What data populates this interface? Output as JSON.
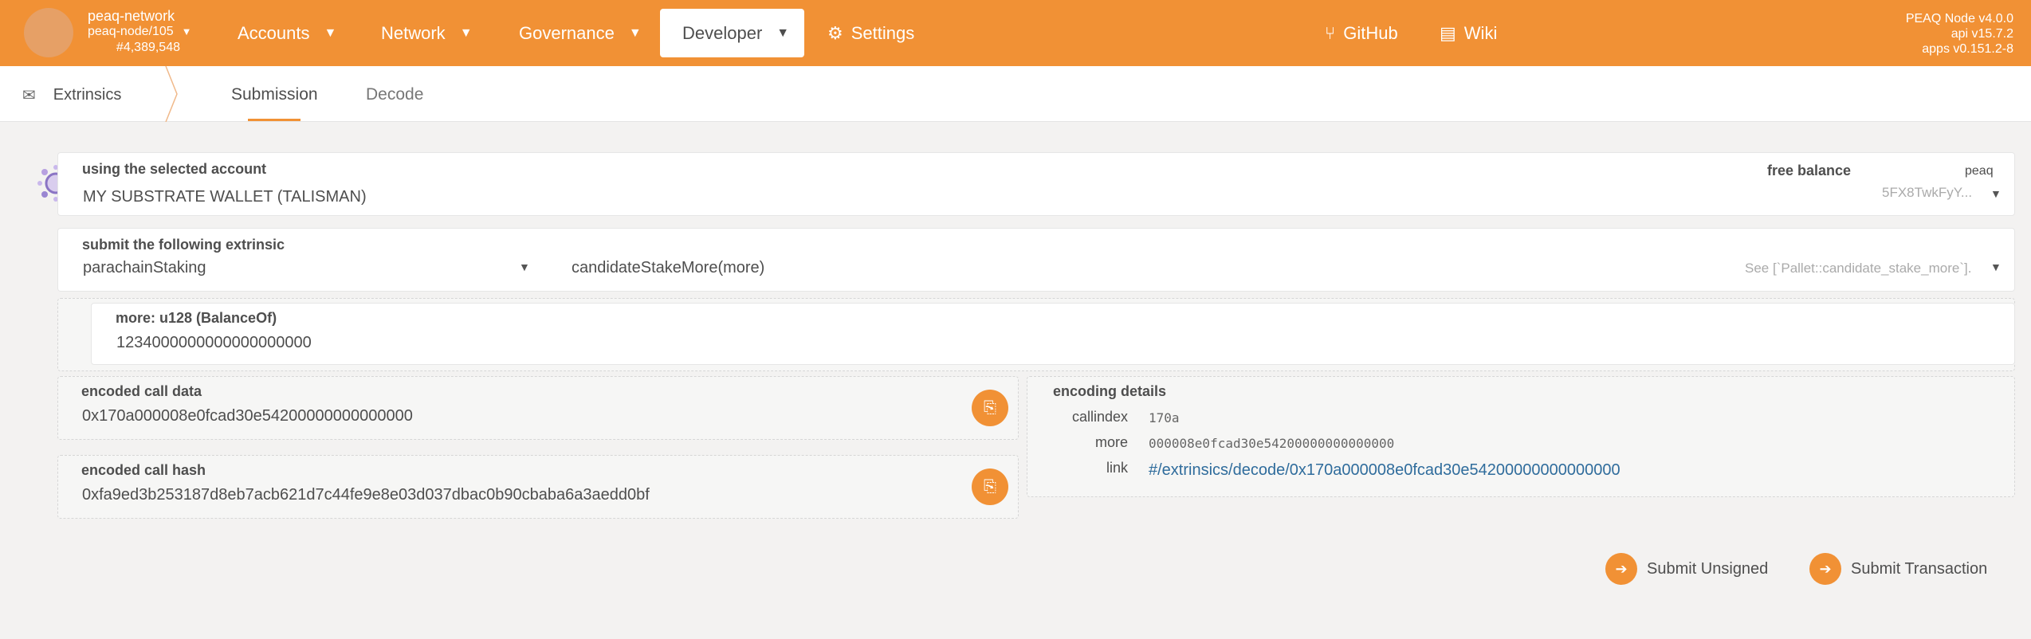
{
  "topbar": {
    "chain_name": "peaq-network",
    "node": "peaq-node/105",
    "block": "#4,389,548",
    "nav": {
      "accounts": "Accounts",
      "network": "Network",
      "governance": "Governance",
      "developer": "Developer",
      "settings": "Settings",
      "github": "GitHub",
      "wiki": "Wiki"
    },
    "node_info": {
      "name": "PEAQ Node v4.0.0",
      "api": "api v15.7.2",
      "apps": "apps v0.151.2-8"
    }
  },
  "tabs": {
    "section": "Extrinsics",
    "submission": "Submission",
    "decode": "Decode"
  },
  "account": {
    "label": "using the selected account",
    "value": "MY SUBSTRATE WALLET (TALISMAN)",
    "free_balance_label": "free balance",
    "balance_unit": "peaq",
    "address": "5FX8TwkFyY..."
  },
  "extrinsic": {
    "label": "submit the following extrinsic",
    "pallet": "parachainStaking",
    "method": "candidateStakeMore(more)",
    "doc": "See [`Pallet::candidate_stake_more`]."
  },
  "param": {
    "label": "more: u128 (BalanceOf)",
    "value": "1234000000000000000000"
  },
  "encoded": {
    "call_data_label": "encoded call data",
    "call_data": "0x170a000008e0fcad30e54200000000000000",
    "call_hash_label": "encoded call hash",
    "call_hash": "0xfa9ed3b253187d8eb7acb621d7c44fe9e8e03d037dbac0b90cbaba6a3aedd0bf"
  },
  "details": {
    "label": "encoding details",
    "callindex_key": "callindex",
    "callindex_val": "170a",
    "more_key": "more",
    "more_val": "000008e0fcad30e54200000000000000",
    "link_key": "link",
    "link_val": "#/extrinsics/decode/0x170a000008e0fcad30e54200000000000000"
  },
  "actions": {
    "submit_unsigned": "Submit Unsigned",
    "submit_transaction": "Submit Transaction"
  },
  "colors": {
    "accent": "#f19135",
    "link": "#2f6c9c"
  }
}
